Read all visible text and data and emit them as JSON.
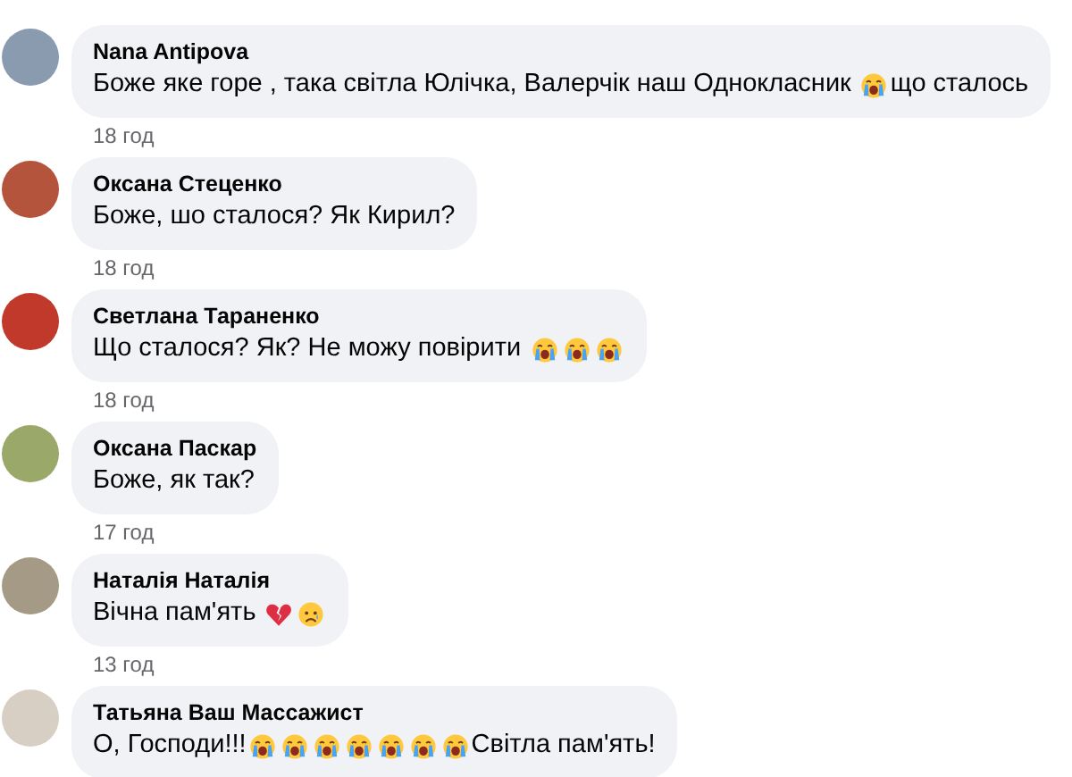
{
  "comments": [
    {
      "author": "Nana Antipova",
      "body": [
        {
          "kind": "text",
          "text": "Боже яке горе , така світла Юлічка, Валерчік наш Однокласник "
        },
        {
          "kind": "crying"
        },
        {
          "kind": "text",
          "text": "що сталось"
        }
      ],
      "time": "18 год"
    },
    {
      "author": "Оксана Стеценко",
      "body": [
        {
          "kind": "text",
          "text": "Боже, шо сталося? Як Кирил?"
        }
      ],
      "time": "18 год"
    },
    {
      "author": "Светлана Тараненко",
      "body": [
        {
          "kind": "text",
          "text": "Що сталося? Як? Не можу повірити "
        },
        {
          "kind": "crying"
        },
        {
          "kind": "crying"
        },
        {
          "kind": "crying"
        }
      ],
      "time": "18 год"
    },
    {
      "author": "Оксана Паскар",
      "body": [
        {
          "kind": "text",
          "text": "Боже, як так?"
        }
      ],
      "time": "17 год"
    },
    {
      "author": "Наталія Наталія",
      "body": [
        {
          "kind": "text",
          "text": "Вічна пам'ять "
        },
        {
          "kind": "broken-heart"
        },
        {
          "kind": "sad"
        }
      ],
      "time": "13 год"
    },
    {
      "author": "Татьяна Ваш Массажист",
      "body": [
        {
          "kind": "text",
          "text": "О, Господи!!!"
        },
        {
          "kind": "crying"
        },
        {
          "kind": "crying"
        },
        {
          "kind": "crying"
        },
        {
          "kind": "crying"
        },
        {
          "kind": "crying"
        },
        {
          "kind": "crying"
        },
        {
          "kind": "crying"
        },
        {
          "kind": "text",
          "text": "Світла пам'ять!"
        }
      ]
    }
  ]
}
